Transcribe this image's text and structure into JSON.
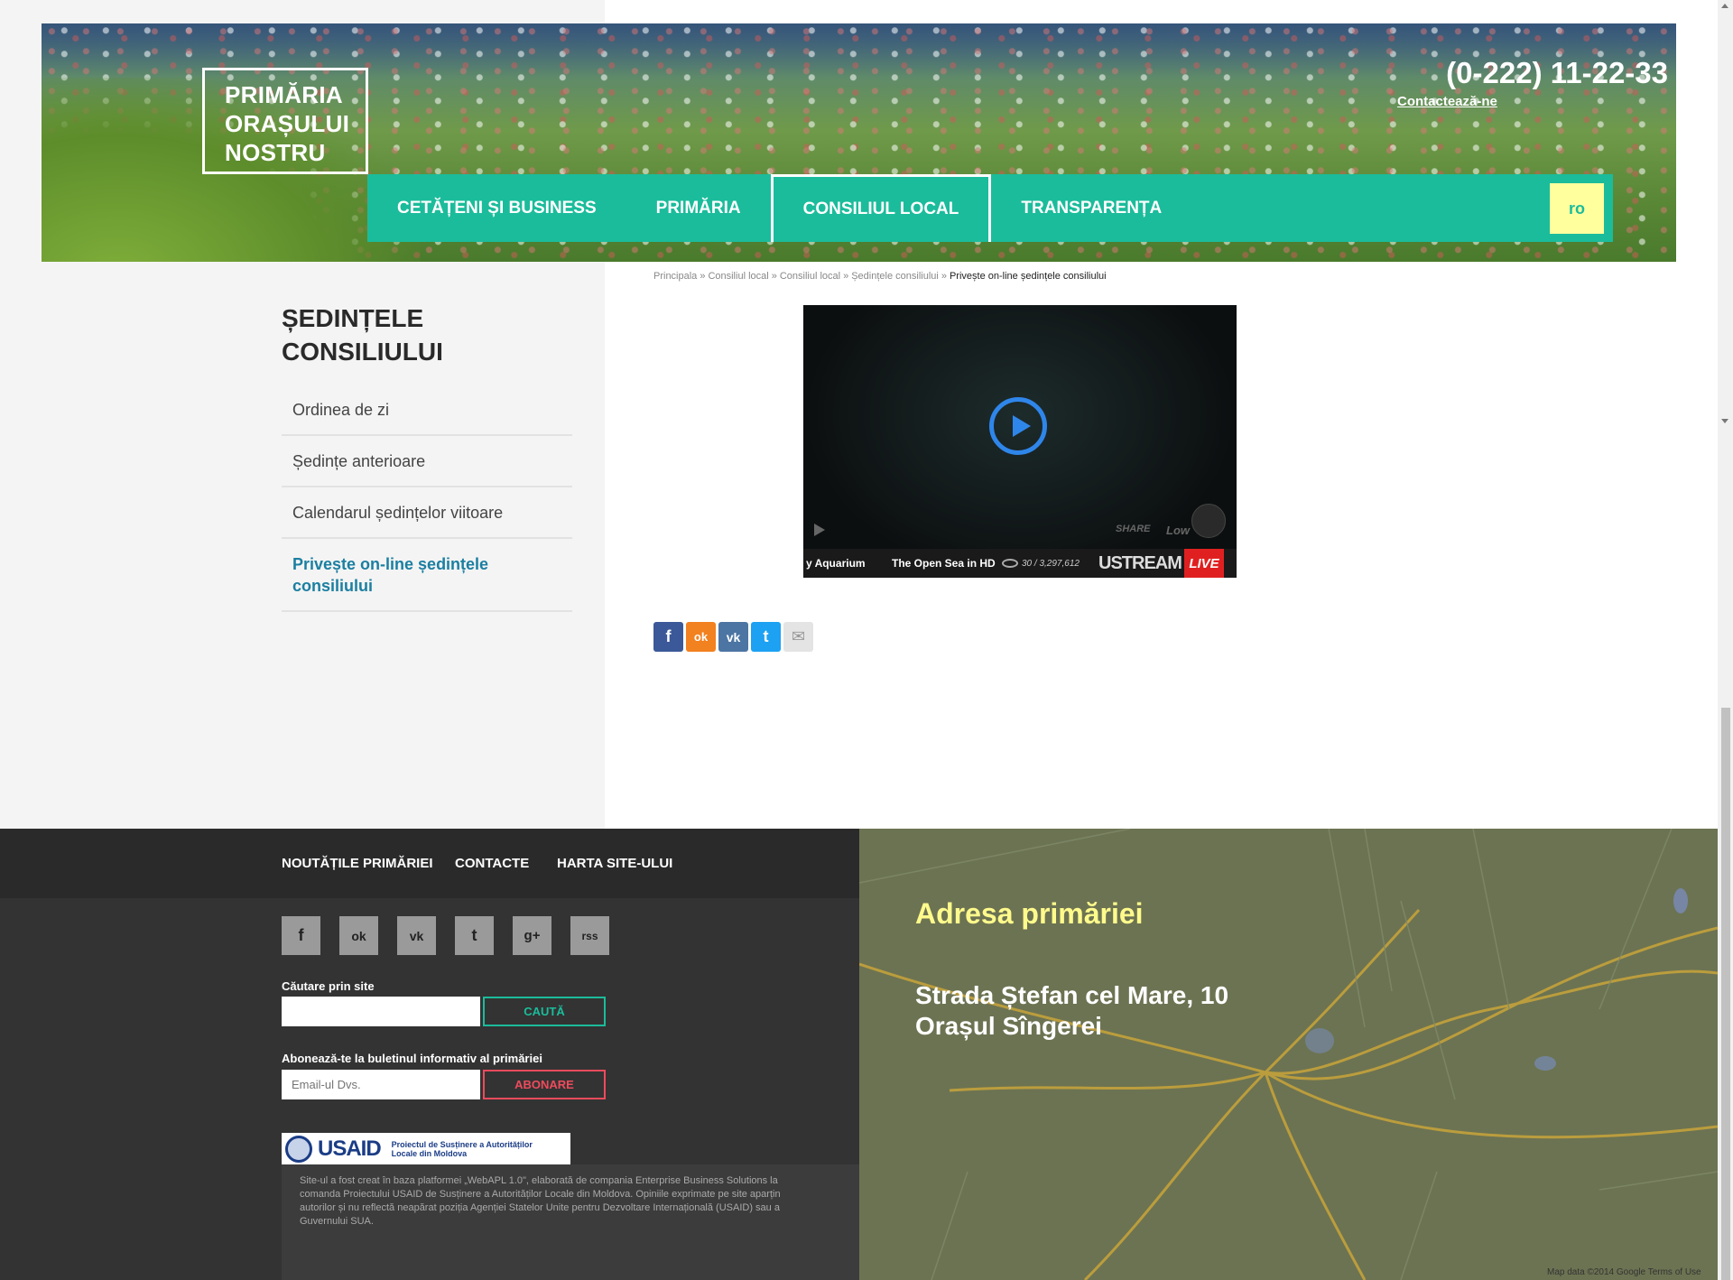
{
  "header": {
    "logo_lines": [
      "PRIMĂRIA",
      "ORAȘULUI",
      "NOSTRU"
    ],
    "phone": "(0-222) 11-22-33",
    "contact_link": "Contactează-ne",
    "nav": [
      {
        "label": "CETĂȚENI ȘI BUSINESS",
        "active": false
      },
      {
        "label": "PRIMĂRIA",
        "active": false
      },
      {
        "label": "CONSILIUL LOCAL",
        "active": true
      },
      {
        "label": "TRANSPARENȚA",
        "active": false
      }
    ],
    "language": "ro"
  },
  "breadcrumb": {
    "items": [
      "Principala",
      "Consiliul local",
      "Consiliul local",
      "Ședințele consiliului"
    ],
    "separator": "»",
    "current": "Privește on-line ședințele consiliului"
  },
  "sidebar": {
    "title": "ȘEDINȚELE CONSILIULUI",
    "items": [
      {
        "label": "Ordinea de zi",
        "active": false
      },
      {
        "label": "Ședințe anterioare",
        "active": false
      },
      {
        "label": "Calendarul ședințelor viitoare",
        "active": false
      },
      {
        "label": "Privește on-line ședințele consiliului",
        "active": true
      }
    ]
  },
  "video": {
    "share_label": "SHARE",
    "quality_label": "Low",
    "channel_1": "y Aquarium",
    "channel_2": "The Open Sea in HD",
    "views": "30 / 3,297,612",
    "brand": "USTREAM",
    "live_label": "LIVE"
  },
  "share_icons": [
    {
      "name": "facebook",
      "glyph": "f",
      "color": "#3b5998"
    },
    {
      "name": "odnoklassniki",
      "glyph": "ok",
      "color": "#f2811f"
    },
    {
      "name": "vk",
      "glyph": "vk",
      "color": "#4c75a3"
    },
    {
      "name": "twitter",
      "glyph": "t",
      "color": "#1da1f2"
    },
    {
      "name": "email",
      "glyph": "✉",
      "color": "#e4e4e4"
    }
  ],
  "footer": {
    "nav": [
      "NOUTĂȚILE PRIMĂRIEI",
      "CONTACTE",
      "HARTA SITE-ULUI"
    ],
    "social": [
      {
        "name": "facebook",
        "glyph": "f"
      },
      {
        "name": "odnoklassniki",
        "glyph": "ok"
      },
      {
        "name": "vk",
        "glyph": "vk"
      },
      {
        "name": "twitter",
        "glyph": "t"
      },
      {
        "name": "google-plus",
        "glyph": "g+"
      },
      {
        "name": "rss",
        "glyph": "rss"
      }
    ],
    "search_label": "Căutare prin site",
    "search_value": "",
    "search_button": "CAUTĂ",
    "newsletter_label": "Abonează-te la buletinul informativ al primăriei",
    "email_placeholder": "Email-ul Dvs.",
    "subscribe_button": "ABONARE",
    "usaid_brand": "USAID",
    "usaid_project": "Proiectul de Susținere a Autorităților Locale din Moldova",
    "disclaimer": "Site-ul a fost creat în baza platformei „WebAPL 1.0\", elaborată de compania Enterprise Business Solutions la comanda Proiectului USAID de Susținere a Autorităților Locale din Moldova. Opiniile exprimate pe site aparțin autorilor și nu reflectă neapărat poziția Agenției Statelor Unite pentru Dezvoltare Internațională (USAID) sau a Guvernului SUA."
  },
  "map": {
    "title": "Adresa primăriei",
    "address_line_1": "Strada Ștefan cel Mare, 10",
    "address_line_2": "Orașul Sîngerei",
    "credit": "Map data ©2014 Google   Terms of Use"
  }
}
